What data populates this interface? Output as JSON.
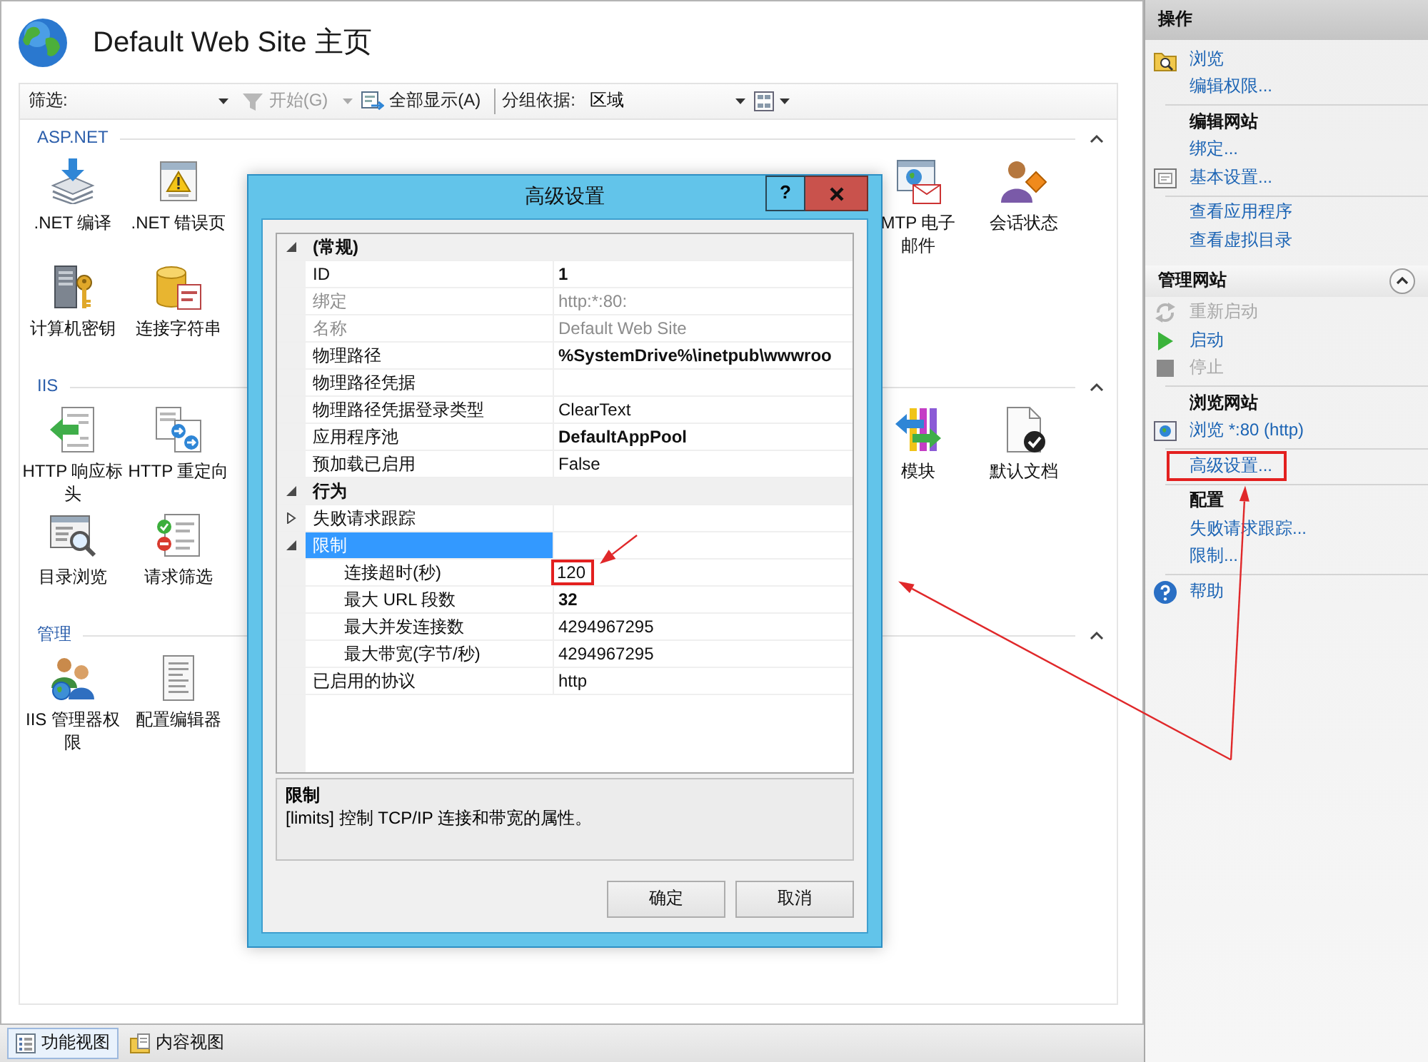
{
  "page": {
    "title": "Default Web Site 主页"
  },
  "toolbar": {
    "filter": {
      "label": "筛选:"
    },
    "start_button": {
      "label": "开始(G)",
      "disabled": true
    },
    "show_all_button": {
      "label": "全部显示(A)"
    },
    "group_by": {
      "label": "分组依据:",
      "value": "区域"
    }
  },
  "sections": [
    {
      "title": "ASP.NET",
      "expanded": true,
      "items_left": [
        ".NET 编译",
        ".NET 错误页",
        "计算机密钥",
        "连接字符串"
      ],
      "items_right": [
        "MTP 电子邮件",
        "会话状态"
      ]
    },
    {
      "title": "IIS",
      "expanded": true,
      "items_left": [
        "HTTP 响应标头",
        "HTTP 重定向",
        "目录浏览",
        "请求筛选"
      ],
      "items_right": [
        "模块",
        "默认文档"
      ]
    },
    {
      "title": "管理",
      "expanded": true,
      "items_left": [
        "IIS 管理器权限",
        "配置编辑器"
      ]
    }
  ],
  "dialog": {
    "title": "高级设置",
    "help_button": "?",
    "properties": [
      {
        "kind": "category",
        "name": "(常规)",
        "expanded": true,
        "selected": false,
        "children": [
          {
            "kind": "property",
            "name": "ID",
            "value": "1",
            "modified": true,
            "readonly": false,
            "selected": false,
            "highlighted": false
          },
          {
            "kind": "property",
            "name": "绑定",
            "value": "http:*:80:",
            "modified": false,
            "readonly": true,
            "selected": false,
            "highlighted": false
          },
          {
            "kind": "property",
            "name": "名称",
            "value": "Default Web Site",
            "modified": false,
            "readonly": true,
            "selected": false,
            "highlighted": false
          },
          {
            "kind": "property",
            "name": "物理路径",
            "value": "%SystemDrive%\\inetpub\\wwwroo",
            "modified": true,
            "readonly": false,
            "selected": false,
            "highlighted": false
          },
          {
            "kind": "property",
            "name": "物理路径凭据",
            "readonly": false,
            "selected": false
          },
          {
            "kind": "property",
            "name": "物理路径凭据登录类型",
            "value": "ClearText",
            "modified": false,
            "readonly": false,
            "selected": false,
            "highlighted": false
          },
          {
            "kind": "property",
            "name": "应用程序池",
            "value": "DefaultAppPool",
            "modified": true,
            "readonly": false,
            "selected": false,
            "highlighted": false
          },
          {
            "kind": "property",
            "name": "预加载已启用",
            "value": "False",
            "modified": false,
            "readonly": false,
            "selected": false,
            "highlighted": false
          }
        ]
      },
      {
        "kind": "category",
        "name": "行为",
        "expanded": true,
        "selected": false,
        "children": [
          {
            "kind": "group",
            "name": "失败请求跟踪",
            "expanded": false,
            "selected": false
          },
          {
            "kind": "group",
            "name": "限制",
            "expanded": true,
            "selected": true,
            "children": [
              {
                "kind": "property",
                "name": "连接超时(秒)",
                "value": "120",
                "modified": false,
                "readonly": false,
                "selected": false,
                "highlighted": true
              },
              {
                "kind": "property",
                "name": "最大 URL 段数",
                "value": "32",
                "modified": true,
                "readonly": false,
                "selected": false,
                "highlighted": false
              },
              {
                "kind": "property",
                "name": "最大并发连接数",
                "value": "4294967295",
                "modified": false,
                "readonly": false,
                "selected": false,
                "highlighted": false
              },
              {
                "kind": "property",
                "name": "最大带宽(字节/秒)",
                "value": "4294967295",
                "modified": false,
                "readonly": false,
                "selected": false,
                "highlighted": false
              }
            ]
          },
          {
            "kind": "property",
            "name": "已启用的协议",
            "value": "http",
            "modified": false,
            "readonly": false,
            "selected": false,
            "highlighted": false
          }
        ]
      }
    ],
    "description": {
      "title": "限制",
      "text": "[limits] 控制 TCP/IP 连接和带宽的属性。"
    },
    "buttons": [
      "确定",
      "取消"
    ]
  },
  "actions_pane": {
    "title": "操作",
    "sections": [
      {
        "groups": [
          {
            "items": [
              {
                "label": "浏览",
                "disabled": false,
                "highlighted": false
              },
              {
                "label": "编辑权限...",
                "disabled": false,
                "highlighted": false
              }
            ]
          },
          {
            "heading": "编辑网站",
            "items": [
              {
                "label": "绑定...",
                "disabled": false,
                "highlighted": false
              },
              {
                "label": "基本设置...",
                "disabled": false,
                "highlighted": false
              }
            ]
          },
          {
            "items": [
              {
                "label": "查看应用程序",
                "disabled": false,
                "highlighted": false
              },
              {
                "label": "查看虚拟目录",
                "disabled": false,
                "highlighted": false
              }
            ]
          }
        ]
      },
      {
        "title": "管理网站",
        "expanded": true,
        "groups": [
          {
            "items": [
              {
                "label": "重新启动",
                "disabled": true,
                "highlighted": false
              },
              {
                "label": "启动",
                "disabled": false,
                "highlighted": false
              },
              {
                "label": "停止",
                "disabled": true,
                "highlighted": false
              }
            ]
          },
          {
            "heading": "浏览网站",
            "items": [
              {
                "label": "浏览 *:80 (http)",
                "disabled": false,
                "highlighted": false
              }
            ]
          },
          {
            "items": [
              {
                "label": "高级设置...",
                "disabled": false,
                "highlighted": true
              }
            ]
          },
          {
            "heading": "配置",
            "items": [
              {
                "label": "失败请求跟踪...",
                "disabled": false,
                "highlighted": false
              },
              {
                "label": "限制...",
                "disabled": false,
                "highlighted": false
              }
            ]
          },
          {
            "items": [
              {
                "label": "帮助",
                "disabled": false,
                "highlighted": false
              }
            ]
          }
        ]
      }
    ]
  },
  "view_tabs": [
    {
      "label": "功能视图",
      "selected": true
    },
    {
      "label": "内容视图",
      "selected": false
    }
  ]
}
